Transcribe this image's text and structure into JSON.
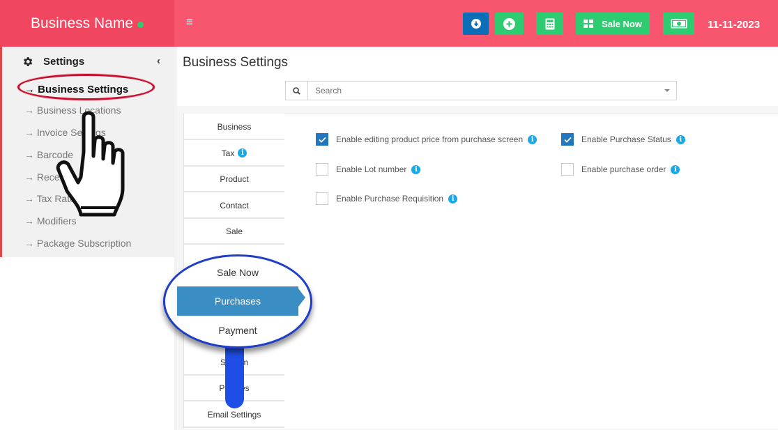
{
  "header": {
    "brand_name": "Business Name",
    "brand_status_color": "#2ecc71",
    "menu_icon": "≡",
    "sale_now_label": "Sale Now",
    "date": "11-11-2023",
    "colors": {
      "brand_bg": "#f0465f",
      "topbar_bg": "#f7566e",
      "download_btn": "#0d6eb8",
      "green_btn": "#2ecc71"
    }
  },
  "sidebar": {
    "section_title": "Settings",
    "items": [
      {
        "label": "→ Business Settings",
        "active": true
      },
      {
        "label": "→ Business Locations"
      },
      {
        "label": "→ Invoice Settings"
      },
      {
        "label": "→ Barcode"
      },
      {
        "label": "→ Receipt"
      },
      {
        "label": "→ Tax Rates"
      },
      {
        "label": "→ Modifiers"
      },
      {
        "label": "→ Package Subscription"
      }
    ]
  },
  "main": {
    "title": "Business Settings",
    "search_placeholder": "Search",
    "tabs": [
      {
        "label": "Business"
      },
      {
        "label": "Tax",
        "info": true
      },
      {
        "label": "Product"
      },
      {
        "label": "Contact"
      },
      {
        "label": "Sale"
      },
      {
        "label": "Sale Now"
      },
      {
        "label": "Purchases",
        "active": true
      },
      {
        "label": "Payment"
      },
      {
        "label": "System"
      },
      {
        "label": "Prefixes"
      },
      {
        "label": "Email Settings"
      }
    ],
    "options": [
      {
        "label": "Enable editing product price from purchase screen",
        "checked": true
      },
      {
        "label": "Enable Purchase Status",
        "checked": true
      },
      {
        "label": "Enable Lot number",
        "checked": false
      },
      {
        "label": "Enable purchase order",
        "checked": false
      },
      {
        "label": "Enable Purchase Requisition",
        "checked": false
      }
    ],
    "info_glyph": "i"
  }
}
